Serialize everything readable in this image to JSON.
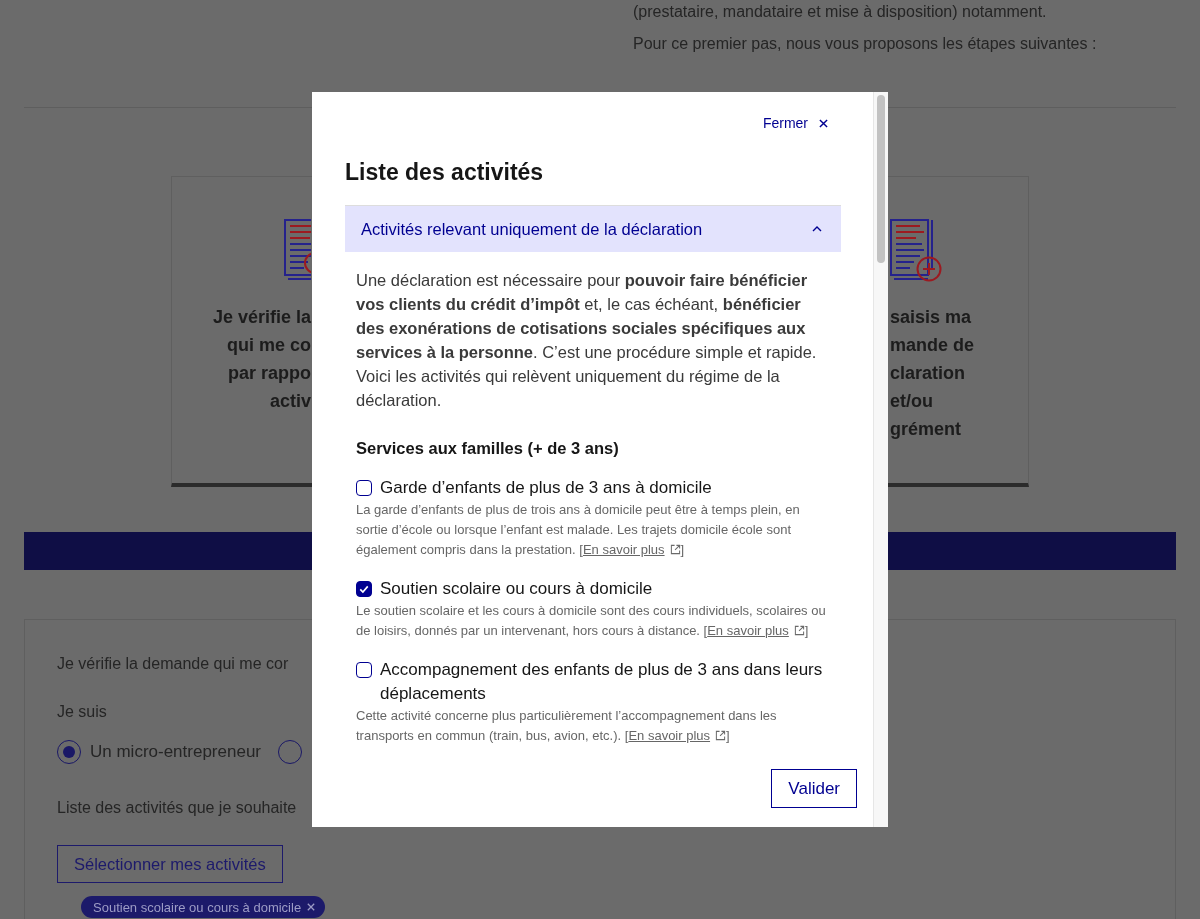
{
  "page": {
    "intro_line": "(prestataire, mandataire et mise à disposition) notamment.",
    "steps_intro": "Pour ce premier pas, nous vous proposons les étapes suivantes :",
    "cards": [
      {
        "kind": "review",
        "lines": [
          "Je vérifie la",
          "qui me co",
          "par rappo",
          "activ"
        ]
      },
      {
        "kind": "add",
        "lines": [
          "saisis ma",
          "mande de",
          "claration",
          "et/ou",
          "grément"
        ]
      }
    ],
    "form": {
      "intro": "Je vérifie la demande qui me cor",
      "status_label": "Je suis",
      "status_options": [
        {
          "label": "Un micro-entrepreneur",
          "selected": true
        },
        {
          "selected": false
        }
      ],
      "activities_label": "Liste des activités que je souhaite",
      "select_button": "Sélectionner mes activités",
      "selected_tags": [
        {
          "label": "Soutien scolaire ou cours à domicile"
        }
      ]
    }
  },
  "modal": {
    "close_label": "Fermer",
    "title": "Liste des activités",
    "accordion": {
      "title": "Activités relevant uniquement de la déclaration",
      "expanded": true,
      "intro": "Une déclaration est nécessaire pour **pouvoir faire bénéficier vos clients du crédit d’impôt** et, le cas échéant, **bénéficier des exonérations de cotisations sociales spécifiques aux services à la personne**. C’est une procédure simple et rapide. Voici les activités qui relèvent uniquement du régime de la déclaration.",
      "group_title": "Services aux familles (+ de 3 ans)",
      "activities": [
        {
          "label": "Garde d’enfants de plus de 3 ans à domicile",
          "checked": false,
          "description": "La garde d’enfants de plus de trois ans à domicile peut être à temps plein, en sortie d’école ou lorsque l’enfant est malade. Les trajets domicile école sont également compris dans la prestation. [",
          "link": "En savoir plus",
          "description_end": "]"
        },
        {
          "label": "Soutien scolaire ou cours à domicile",
          "checked": true,
          "description": "Le soutien scolaire et les cours à domicile sont des cours individuels, scolaires ou de loisirs, donnés par un intervenant, hors cours à distance. [",
          "link": "En savoir plus",
          "description_end": "]"
        },
        {
          "label": "Accompagnement des enfants de plus de 3 ans dans leurs déplacements",
          "checked": false,
          "description": "Cette activité concerne plus particulièrement l’accompagnement dans les transports en commun (train, bus, avion, etc.). [",
          "link": "En savoir plus",
          "description_end": "]"
        }
      ]
    },
    "submit_button": "Valider"
  }
}
